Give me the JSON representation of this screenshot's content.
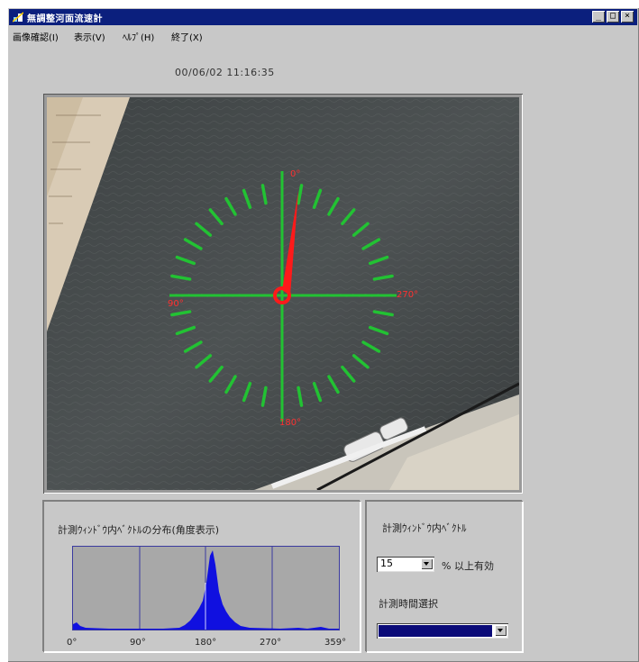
{
  "window": {
    "title": "無調整河面流速計",
    "buttons": [
      "_",
      "□",
      "×"
    ]
  },
  "menu": [
    {
      "label": "画像確認(I)"
    },
    {
      "label": "表示(V)"
    },
    {
      "label": "ﾍﾙﾌﾟ(H)"
    },
    {
      "label": "終了(X)"
    }
  ],
  "timestamp": "00/06/02 11:16:35",
  "compass": {
    "needle_angle_deg": 15,
    "labels": {
      "top": "0°",
      "left": "90°",
      "right": "270°",
      "bottom": "180°"
    },
    "ring_color": "#22c233",
    "needle_color": "#ff1a1a"
  },
  "histogram_panel": {
    "title": "計測ｳｨﾝﾄﾞｳ内ﾍﾞｸﾄﾙの分布(角度表示)",
    "ticks": [
      "0°",
      "90°",
      "180°",
      "270°",
      "359°"
    ],
    "bar_color": "#1010e0"
  },
  "vector_panel": {
    "title": "計測ｳｨﾝﾄﾞｳ内ﾍﾞｸﾄﾙ",
    "threshold_value": "15",
    "threshold_suffix": "% 以上有効",
    "time_label": "計測時間選択",
    "time_value": ""
  }
}
